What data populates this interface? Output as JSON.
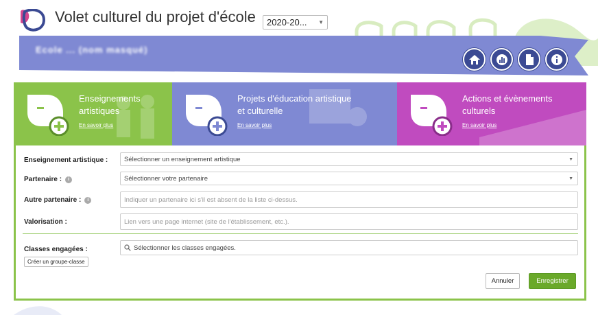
{
  "header": {
    "title": "Volet culturel du projet d'école",
    "year_select": "2020-20...",
    "school_name": "Ecole ... (nom masqué)"
  },
  "nav": [
    {
      "name": "home-icon"
    },
    {
      "name": "stats-icon"
    },
    {
      "name": "document-icon"
    },
    {
      "name": "info-icon"
    }
  ],
  "tiles": [
    {
      "title_line1": "Enseignements",
      "title_line2": "artistiques",
      "link": "En savoir plus",
      "color": "#8bc34a"
    },
    {
      "title_line1": "Projets d'éducation artistique",
      "title_line2": "et culturelle",
      "link": "En savoir plus",
      "color": "#7f89d3"
    },
    {
      "title_line1": "Actions et évènements",
      "title_line2": "culturels",
      "link": "En savoir plus",
      "color": "#c04bbf"
    }
  ],
  "form": {
    "enseignement_label": "Enseignement artistique :",
    "enseignement_value": "Sélectionner un enseignement artistique",
    "partenaire_label": "Partenaire :",
    "partenaire_value": "Sélectionner votre partenaire",
    "autre_label": "Autre partenaire :",
    "autre_placeholder": "Indiquer un partenaire ici s'il est absent de la liste ci-dessus.",
    "valorisation_label": "Valorisation :",
    "valorisation_placeholder": "Lien vers une page internet (site de l'établissement, etc.).",
    "classes_label": "Classes engagées :",
    "classes_placeholder": "Sélectionner les classes engagées.",
    "create_group_button": "Créer un groupe-classe",
    "cancel_button": "Annuler",
    "save_button": "Enregistrer"
  },
  "colors": {
    "primary_dark": "#3b4a93",
    "banner": "#7f89d3",
    "green": "#8bc34a",
    "save_green": "#6aa92a"
  }
}
